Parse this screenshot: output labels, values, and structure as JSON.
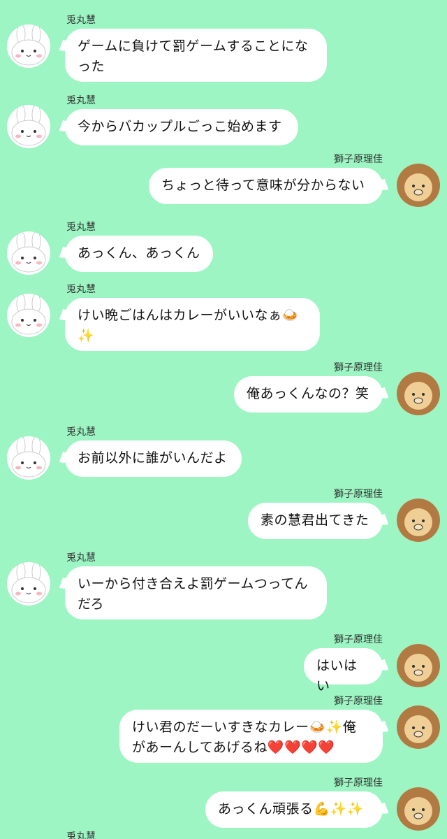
{
  "chat": {
    "messages": [
      {
        "side": "left",
        "sender": "兎丸慧",
        "text": "ゲームに負けて罰ゲームすることにな\nった"
      },
      {
        "side": "left",
        "sender": "兎丸慧",
        "text": "今からバカップルごっこ始めます"
      },
      {
        "side": "right",
        "sender": "獅子原理佳",
        "text": "ちょっと待って意味が分からない"
      },
      {
        "side": "left",
        "sender": "兎丸慧",
        "text": "あっくん、あっくん"
      },
      {
        "side": "left",
        "sender": "兎丸慧",
        "text": "けい晩ごはんはカレーがいいなぁ🍛\n✨"
      },
      {
        "side": "right",
        "sender": "獅子原理佳",
        "text": "俺あっくんなの？笑"
      },
      {
        "side": "left",
        "sender": "兎丸慧",
        "text": "お前以外に誰がいんだよ"
      },
      {
        "side": "right",
        "sender": "獅子原理佳",
        "text": "素の慧君出てきた"
      },
      {
        "side": "left",
        "sender": "兎丸慧",
        "text": "いーから付き合えよ罰ゲームつってん\nだろ"
      },
      {
        "side": "right",
        "sender": "獅子原理佳",
        "text": "はいはい"
      },
      {
        "side": "right",
        "sender": "獅子原理佳",
        "text": "けい君のだーいすきなカレー🍛✨俺\nがあーんしてあげるね❤️❤️❤️❤️"
      },
      {
        "side": "right",
        "sender": "獅子原理佳",
        "text": "あっくん頑張る💪✨✨"
      }
    ],
    "partial_sender": "兎丸慧"
  },
  "colors": {
    "background": "#9cf5c3",
    "bubble": "#ffffff"
  },
  "icons": {
    "left_avatar": "rabbit-avatar-icon",
    "right_avatar": "lion-avatar-icon"
  }
}
